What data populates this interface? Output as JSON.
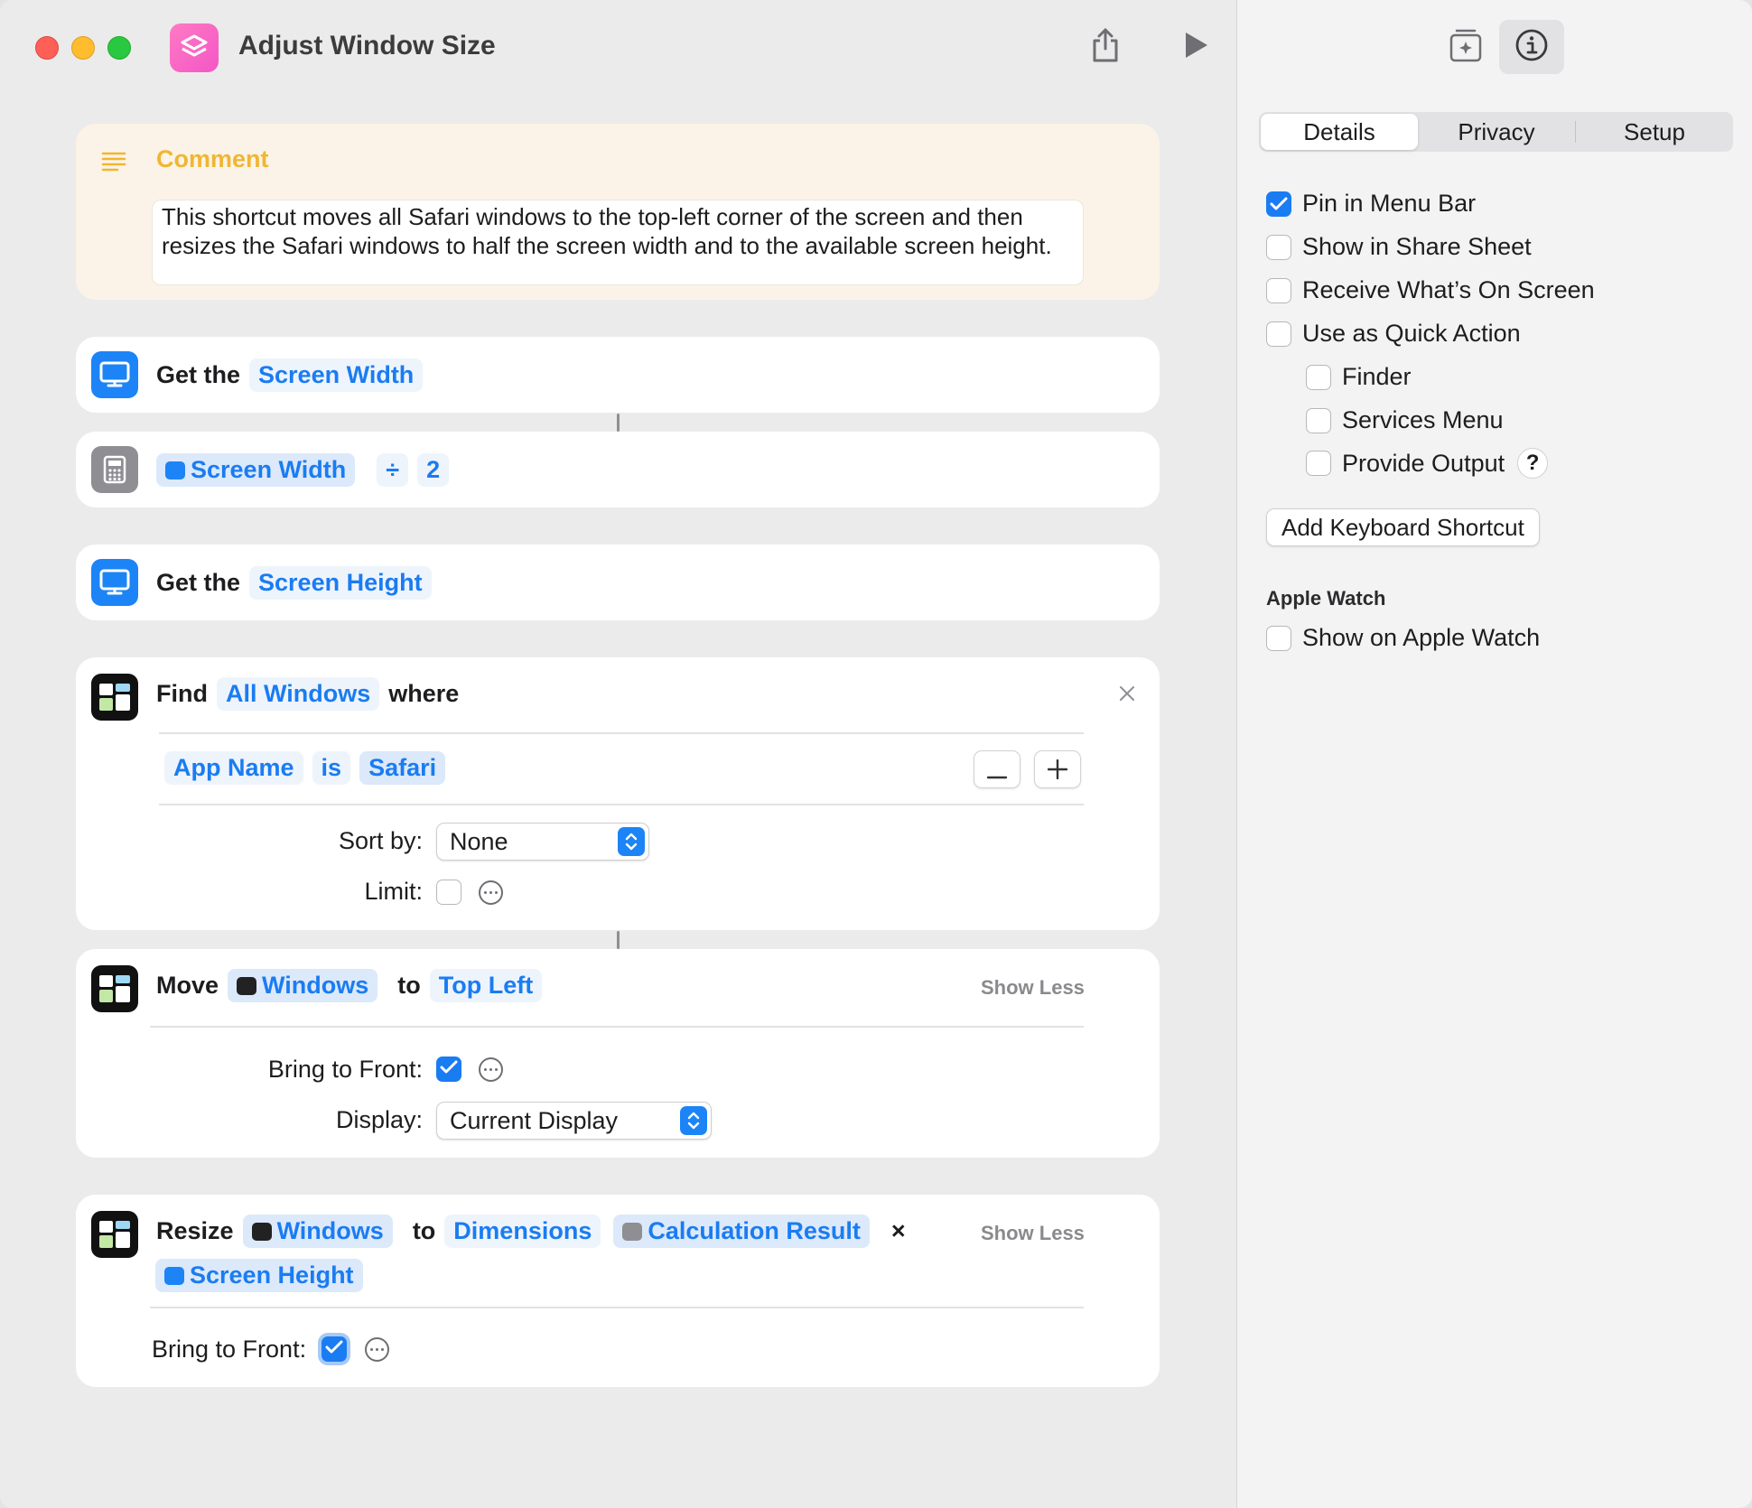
{
  "window": {
    "title": "Adjust Window Size"
  },
  "toolbar": {
    "share_icon": "share-icon",
    "run_icon": "play-icon",
    "library_icon": "add-action-icon",
    "info_icon": "info-icon"
  },
  "comment": {
    "heading": "Comment",
    "text": "This shortcut moves all Safari windows to the top-left corner of the screen and then resizes the Safari windows to half the screen width and to the available screen height."
  },
  "actions": {
    "get_width": {
      "verb": "Get the",
      "param": "Screen Width"
    },
    "calc": {
      "var": "Screen Width",
      "operator": "÷",
      "operand": "2"
    },
    "get_height": {
      "verb": "Get the",
      "param": "Screen Height"
    },
    "find": {
      "verb": "Find",
      "param": "All Windows",
      "suffix": "where",
      "filter": {
        "field": "App Name",
        "op": "is",
        "value": "Safari"
      },
      "sort_label": "Sort by:",
      "sort_value": "None",
      "limit_label": "Limit:"
    },
    "move": {
      "verb": "Move",
      "param": "Windows",
      "to": "to",
      "position": "Top Left",
      "show_less": "Show Less",
      "bring_label": "Bring to Front:",
      "display_label": "Display:",
      "display_value": "Current Display"
    },
    "resize": {
      "verb": "Resize",
      "param": "Windows",
      "to": "to",
      "mode": "Dimensions",
      "width_var": "Calculation Result",
      "times": "×",
      "height_var": "Screen Height",
      "show_less": "Show Less",
      "bring_label": "Bring to Front:"
    }
  },
  "inspector": {
    "tabs": [
      "Details",
      "Privacy",
      "Setup"
    ],
    "options": [
      {
        "label": "Pin in Menu Bar",
        "checked": true
      },
      {
        "label": "Show in Share Sheet",
        "checked": false
      },
      {
        "label": "Receive What’s On Screen",
        "checked": false
      },
      {
        "label": "Use as Quick Action",
        "checked": false
      },
      {
        "label": "Finder",
        "checked": false
      },
      {
        "label": "Services Menu",
        "checked": false
      },
      {
        "label": "Provide Output",
        "checked": false
      }
    ],
    "help": "?",
    "keyboard_button": "Add Keyboard Shortcut",
    "watch_section": "Apple Watch",
    "watch_option": {
      "label": "Show on Apple Watch",
      "checked": false
    }
  },
  "colors": {
    "accent": "#1a7cf2",
    "comment_bg": "#fbf3e7",
    "comment_heading": "#f0b632",
    "app_icon": "#f456c6"
  }
}
